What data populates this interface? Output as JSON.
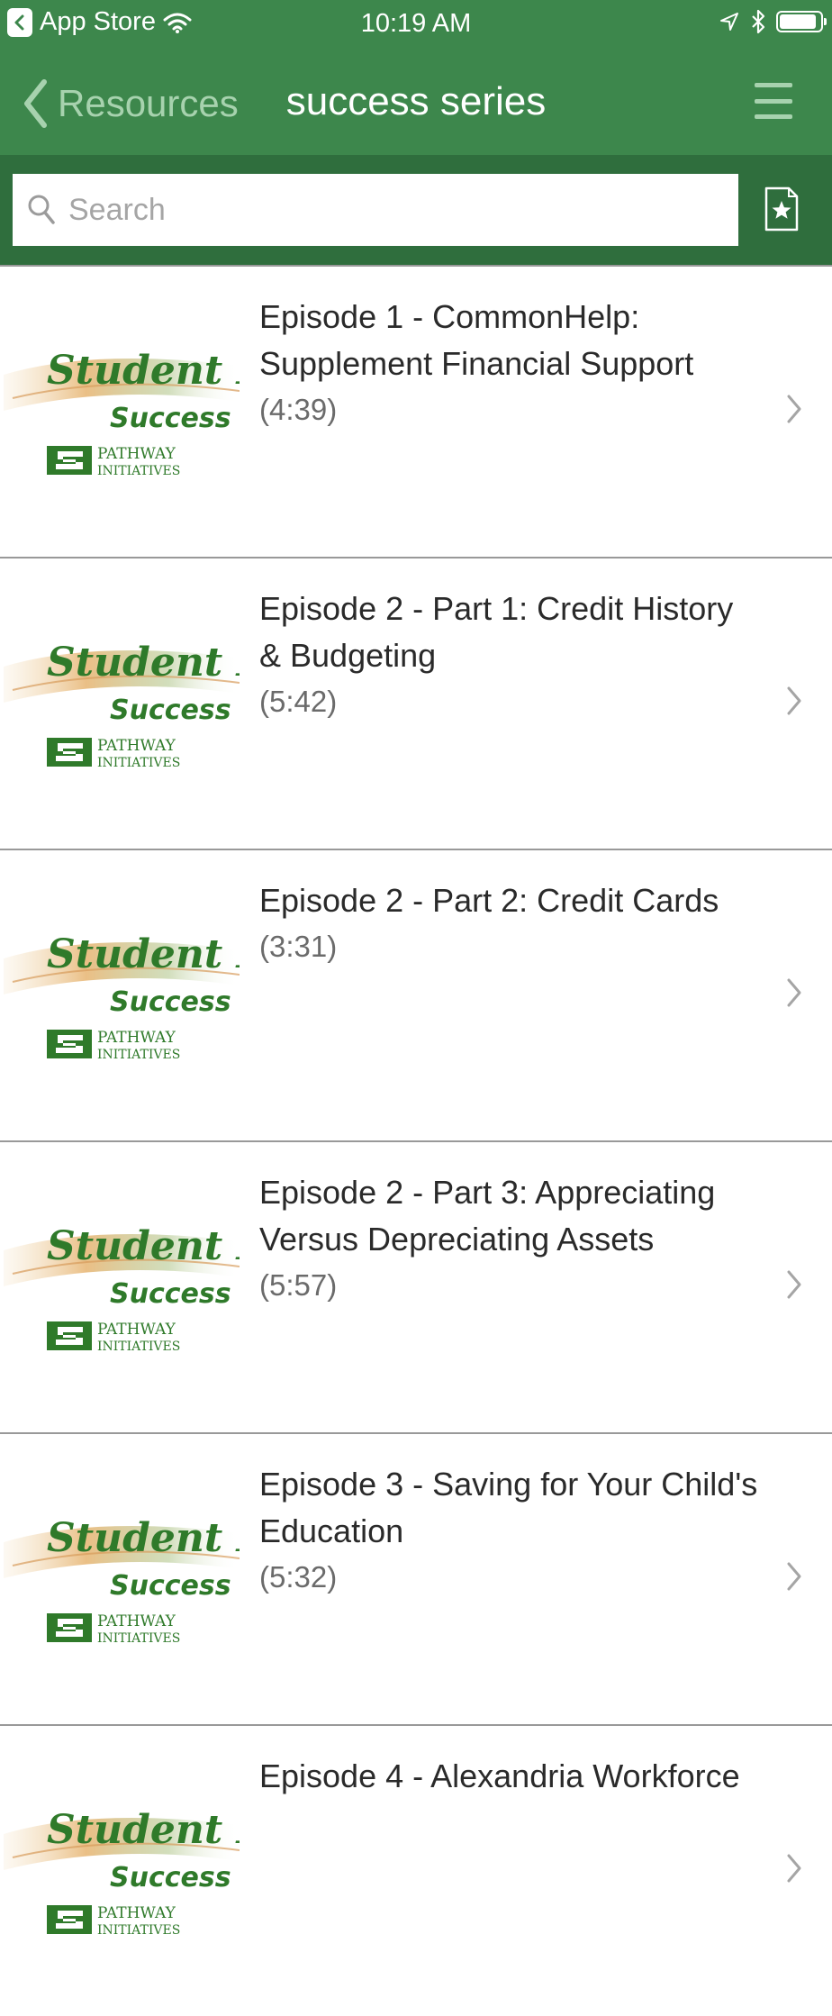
{
  "status_bar": {
    "back_app": "App Store",
    "time": "10:19 AM",
    "battery_level": 0.92
  },
  "nav": {
    "back_label": "Resources",
    "title": "success series"
  },
  "search": {
    "placeholder": "Search"
  },
  "thumbnail": {
    "line1": "Student Re",
    "line2": "Success S",
    "org_line1": "PATHWAY",
    "org_line2": "INITIATIVES"
  },
  "episodes": [
    {
      "title": "Episode 1 - CommonHelp: Supplement Financial Support",
      "duration": "(4:39)"
    },
    {
      "title": "Episode 2 - Part 1: Credit History & Budgeting",
      "duration": "(5:42)"
    },
    {
      "title": "Episode 2 - Part 2: Credit Cards",
      "duration": "(3:31)"
    },
    {
      "title": "Episode 2 - Part 3: Appreciating Versus Depreciating Assets",
      "duration": "(5:57)"
    },
    {
      "title": "Episode 3 - Saving for Your Child's Education",
      "duration": "(5:32)"
    },
    {
      "title": "Episode 4 - Alexandria Workforce",
      "duration": ""
    }
  ],
  "colors": {
    "nav_green": "#3d874c",
    "search_green": "#2f6e3d",
    "accent_light": "#a7d2ae",
    "logo_green": "#2f7a2a"
  }
}
